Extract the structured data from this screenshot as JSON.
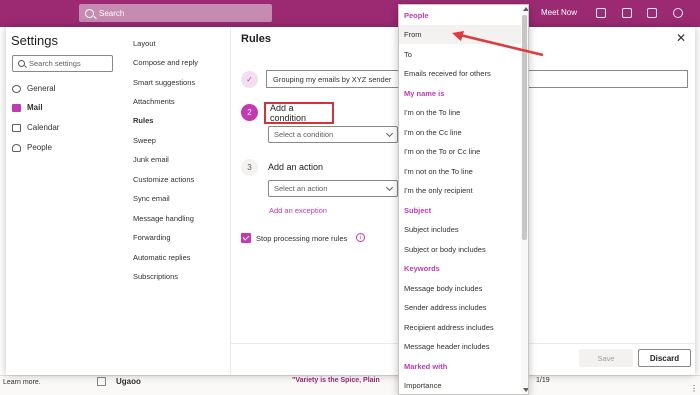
{
  "topbar": {
    "search_placeholder": "Search",
    "meet_now": "Meet Now"
  },
  "background": {
    "learn_more": "Learn more.",
    "sender": "Ugaoo",
    "subject": "\"Variety is the Spice, Plain",
    "date": "1/19"
  },
  "settings": {
    "title": "Settings",
    "search_placeholder": "Search settings",
    "categories": [
      {
        "label": "General",
        "icon": "gear-icon"
      },
      {
        "label": "Mail",
        "icon": "mail-icon"
      },
      {
        "label": "Calendar",
        "icon": "calendar-icon"
      },
      {
        "label": "People",
        "icon": "people-icon"
      }
    ],
    "subcategories": [
      "Layout",
      "Compose and reply",
      "Smart suggestions",
      "Attachments",
      "Rules",
      "Sweep",
      "Junk email",
      "Customize actions",
      "Sync email",
      "Message handling",
      "Forwarding",
      "Automatic replies",
      "Subscriptions"
    ]
  },
  "rules": {
    "title": "Rules",
    "rule_name": "Grouping my emails by XYZ sender",
    "step2_number": "2",
    "add_condition": "Add a condition",
    "condition_placeholder": "Select a condition",
    "step3_number": "3",
    "add_action": "Add an action",
    "action_placeholder": "Select an action",
    "add_exception": "Add an exception",
    "stop_processing": "Stop processing more rules",
    "save": "Save",
    "discard": "Discard"
  },
  "dropdown": {
    "items": [
      {
        "label": "People",
        "header": true
      },
      {
        "label": "From",
        "header": false,
        "hover": true
      },
      {
        "label": "To",
        "header": false
      },
      {
        "label": "Emails received for others",
        "header": false
      },
      {
        "label": "My name is",
        "header": true
      },
      {
        "label": "I'm on the To line",
        "header": false
      },
      {
        "label": "I'm on the Cc line",
        "header": false
      },
      {
        "label": "I'm on the To or Cc line",
        "header": false
      },
      {
        "label": "I'm not on the To line",
        "header": false
      },
      {
        "label": "I'm the only recipient",
        "header": false
      },
      {
        "label": "Subject",
        "header": true
      },
      {
        "label": "Subject includes",
        "header": false
      },
      {
        "label": "Subject or body includes",
        "header": false
      },
      {
        "label": "Keywords",
        "header": true
      },
      {
        "label": "Message body includes",
        "header": false
      },
      {
        "label": "Sender address includes",
        "header": false
      },
      {
        "label": "Recipient address includes",
        "header": false
      },
      {
        "label": "Message header includes",
        "header": false
      },
      {
        "label": "Marked with",
        "header": true
      },
      {
        "label": "Importance",
        "header": false
      }
    ]
  },
  "colors": {
    "brand": "#9b2a73",
    "accent": "#c239b3",
    "highlight_box": "#d13438",
    "annotation_arrow": "#e0393e"
  }
}
